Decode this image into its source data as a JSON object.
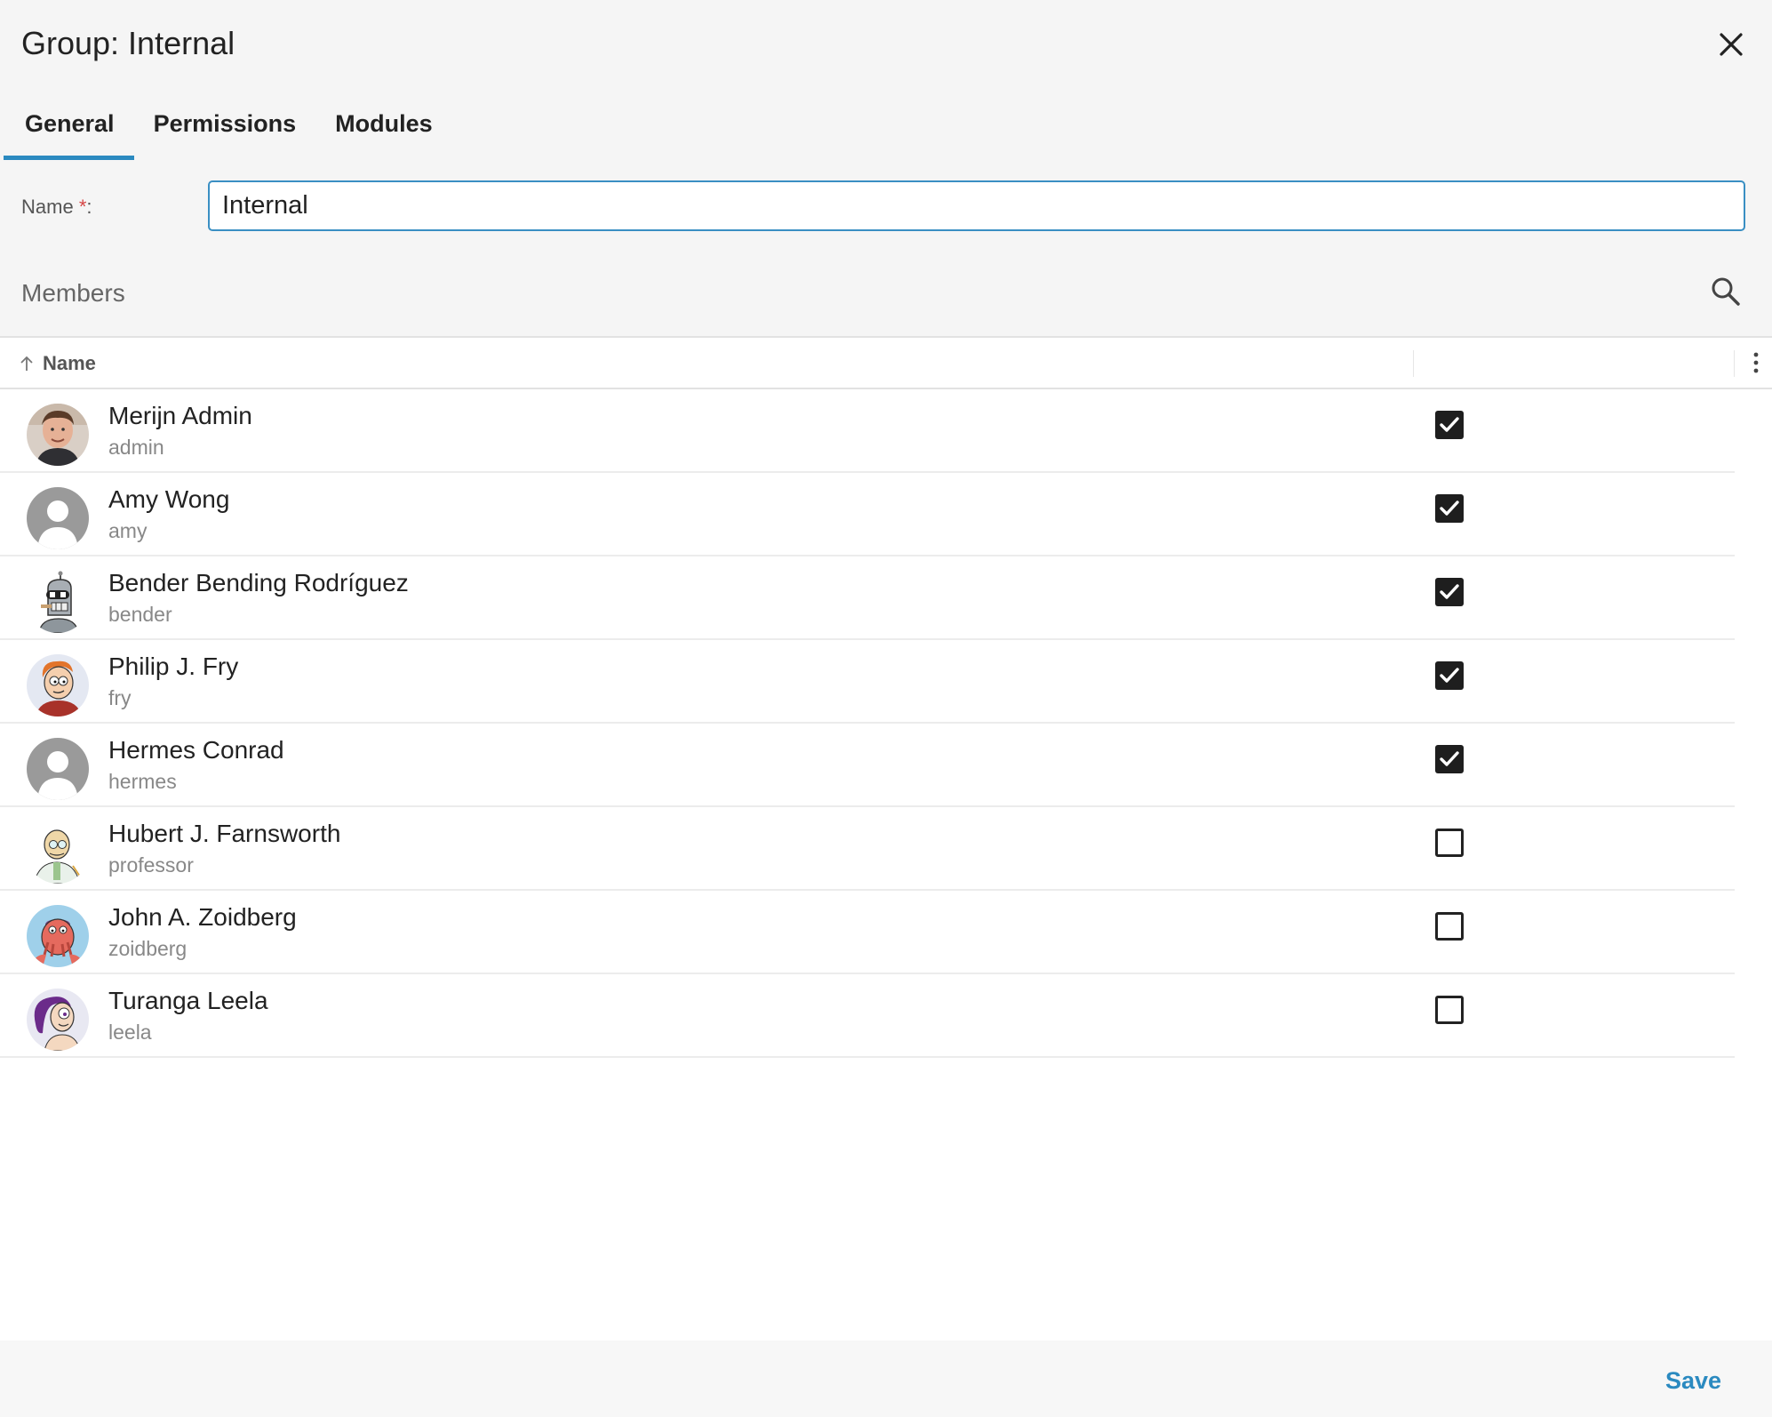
{
  "dialog": {
    "title": "Group: Internal",
    "close_icon": "close-icon"
  },
  "tabs": [
    {
      "label": "General",
      "active": true
    },
    {
      "label": "Permissions",
      "active": false
    },
    {
      "label": "Modules",
      "active": false
    }
  ],
  "form": {
    "name_label": "Name",
    "required_marker": "*",
    "name_colon": ":",
    "name_value": "Internal"
  },
  "members": {
    "title": "Members",
    "search_icon": "search-icon",
    "column_name": "Name",
    "sort_icon": "arrow-up-icon",
    "more_icon": "kebab-menu-icon",
    "rows": [
      {
        "name": "Merijn Admin",
        "login": "admin",
        "member": true,
        "avatar": "photo"
      },
      {
        "name": "Amy Wong",
        "login": "amy",
        "member": true,
        "avatar": "placeholder"
      },
      {
        "name": "Bender Bending Rodríguez",
        "login": "bender",
        "member": true,
        "avatar": "robot"
      },
      {
        "name": "Philip J. Fry",
        "login": "fry",
        "member": true,
        "avatar": "cartoon-orange-hair"
      },
      {
        "name": "Hermes Conrad",
        "login": "hermes",
        "member": true,
        "avatar": "placeholder"
      },
      {
        "name": "Hubert J. Farnsworth",
        "login": "professor",
        "member": false,
        "avatar": "cartoon-professor"
      },
      {
        "name": "John A. Zoidberg",
        "login": "zoidberg",
        "member": false,
        "avatar": "cartoon-red"
      },
      {
        "name": "Turanga Leela",
        "login": "leela",
        "member": false,
        "avatar": "cartoon-purple-hair"
      }
    ]
  },
  "footer": {
    "save_label": "Save"
  },
  "colors": {
    "accent": "#2b8ac0",
    "required": "#d64545",
    "header_bg": "#f5f5f5"
  }
}
